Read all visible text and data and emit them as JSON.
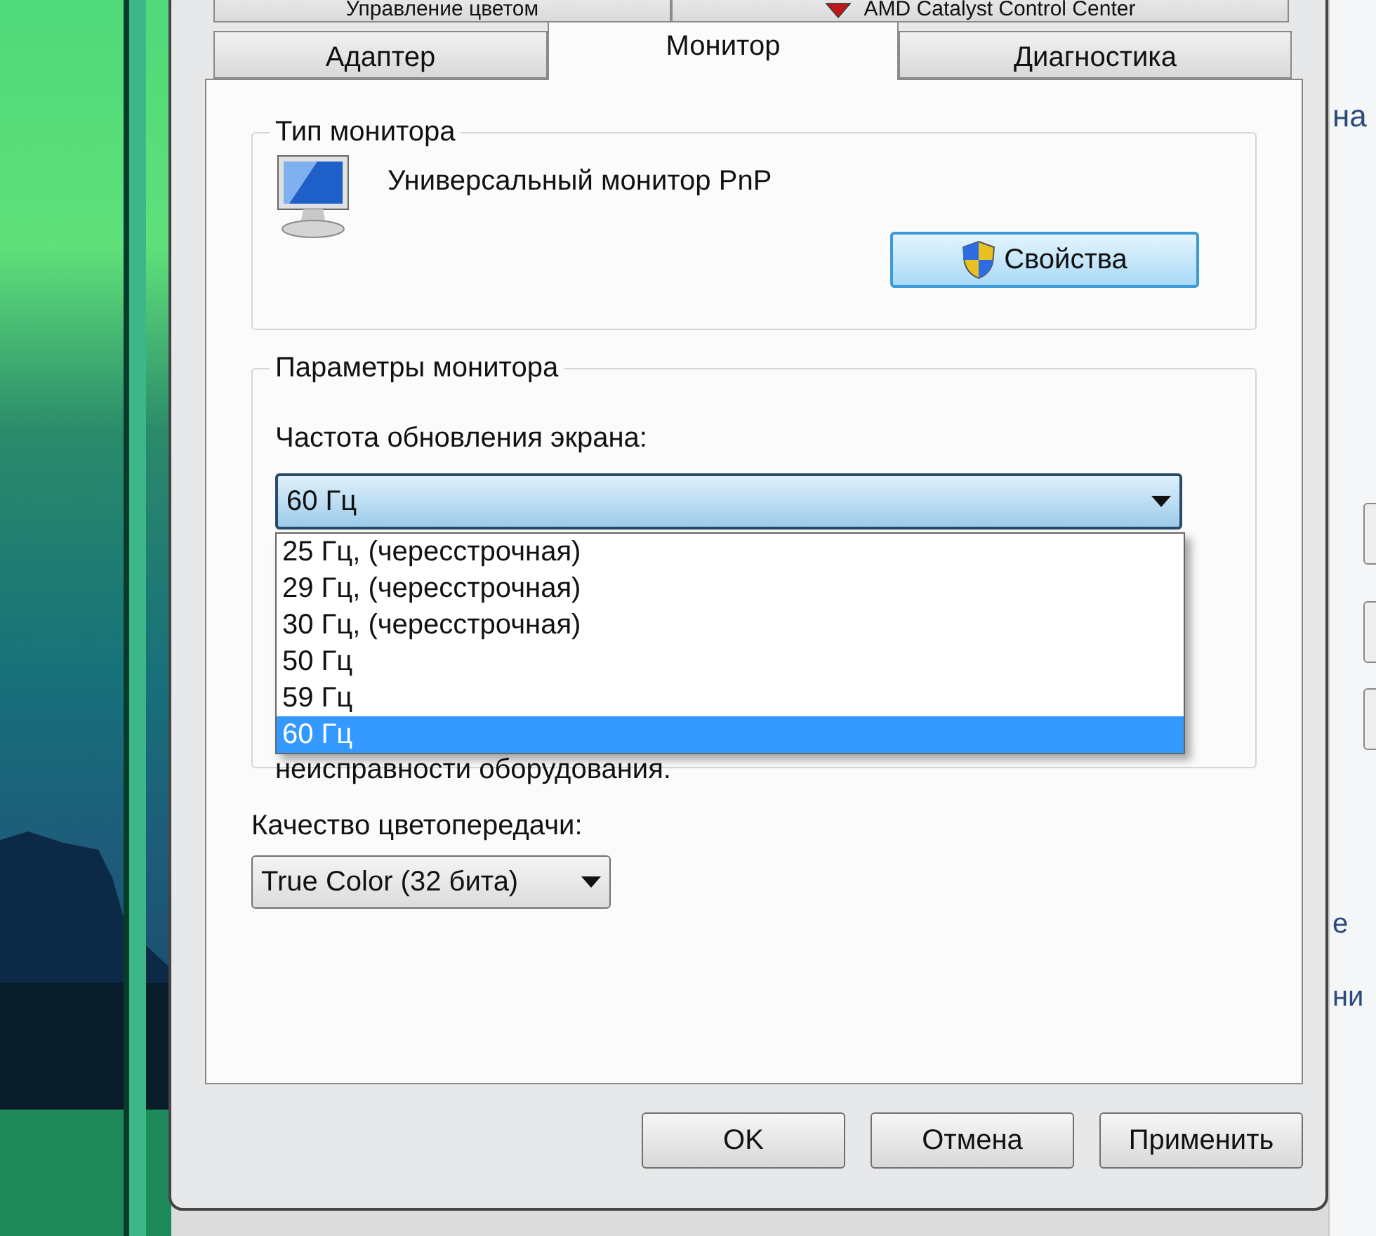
{
  "tabs_back_row": [
    {
      "label": "Управление цветом",
      "selected": false,
      "kind": "plain"
    },
    {
      "label": "AMD Catalyst Control Center",
      "selected": false,
      "kind": "app"
    }
  ],
  "tabs": [
    {
      "label": "Адаптер",
      "selected": false
    },
    {
      "label": "Монитор",
      "selected": true
    },
    {
      "label": "Диагностика",
      "selected": false
    }
  ],
  "monitor_type": {
    "title": "Тип монитора",
    "name": "Универсальный монитор PnP",
    "properties_button": "Свойства"
  },
  "monitor_settings": {
    "title": "Параметры монитора",
    "refresh_label": "Частота обновления экрана:",
    "refresh_value": "60 Гц",
    "expanded": true,
    "refresh_options": [
      {
        "label": "25 Гц, (чересстрочная)",
        "selected": false
      },
      {
        "label": "29 Гц, (чересстрочная)",
        "selected": false
      },
      {
        "label": "30 Гц, (чересстрочная)",
        "selected": false
      },
      {
        "label": "50 Гц",
        "selected": false
      },
      {
        "label": "59 Гц",
        "selected": false
      },
      {
        "label": "60 Гц",
        "selected": true
      }
    ],
    "note": "неисправности оборудования."
  },
  "color_quality": {
    "label": "Качество цветопередачи:",
    "value": "True Color (32 бита)"
  },
  "buttons": [
    "OK",
    "Отмена",
    "Применить"
  ],
  "background_window": {
    "fragments": [
      "на",
      "е",
      "ни"
    ]
  }
}
